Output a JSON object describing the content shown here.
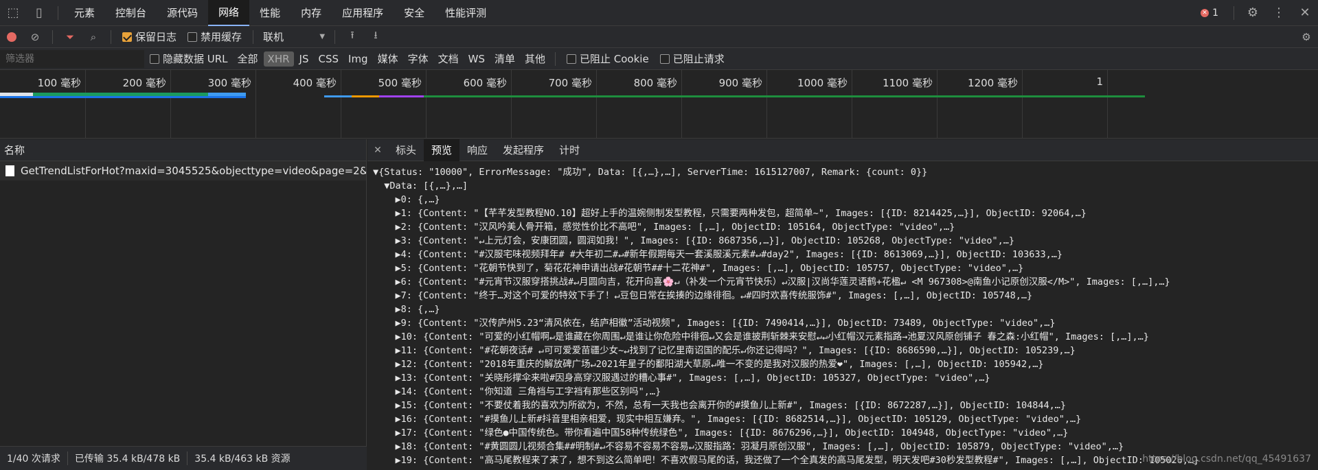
{
  "tabs": [
    "元素",
    "控制台",
    "源代码",
    "网络",
    "性能",
    "内存",
    "应用程序",
    "安全",
    "性能评测"
  ],
  "active_tab": "网络",
  "error_count": "1",
  "toolbar": {
    "preserve_log": "保留日志",
    "disable_cache": "禁用缓存",
    "throttle": "联机"
  },
  "filterbar": {
    "placeholder": "筛选器",
    "hide_data_urls": "隐藏数据 URL",
    "types": [
      "全部",
      "XHR",
      "JS",
      "CSS",
      "Img",
      "媒体",
      "字体",
      "文档",
      "WS",
      "清单",
      "其他"
    ],
    "blocked_cookies": "已阻止 Cookie",
    "blocked_requests": "已阻止请求"
  },
  "timeline": {
    "ticks": [
      "100 毫秒",
      "200 毫秒",
      "300 毫秒",
      "400 毫秒",
      "500 毫秒",
      "600 毫秒",
      "700 毫秒",
      "800 毫秒",
      "900 毫秒",
      "1000 毫秒",
      "1100 毫秒",
      "1200 毫秒",
      "1"
    ]
  },
  "left": {
    "header": "名称",
    "request": "GetTrendListForHot?maxid=3045525&objecttype=video&page=2&count..."
  },
  "right_tabs": [
    "标头",
    "预览",
    "响应",
    "发起程序",
    "计时"
  ],
  "active_right_tab": "预览",
  "preview_lines": [
    "▼{Status: \"10000\", ErrorMessage: \"成功\", Data: [{,…},…], ServerTime: 1615127007, Remark: {count: 0}}",
    "  ▼Data: [{,…},…]",
    "    ▶0: {,…}",
    "    ▶1: {Content: \"【芊芊发型教程NO.10】超好上手的温婉侧制发型教程，只需要两种发包，超简单~\", Images: [{ID: 8214425,…}], ObjectID: 92064,…}",
    "    ▶2: {Content: \"汉风吟美人骨开箱，感觉性价比不高吧\", Images: [,…], ObjectID: 105164, ObjectType: \"video\",…}",
    "    ▶3: {Content: \"↵上元灯会，安康团圆，圆润如我！\", Images: [{ID: 8687356,…}], ObjectID: 105268, ObjectType: \"video\",…}",
    "    ▶4: {Content: \"#汉服宅味视频拜年# #大年初二#↵#新年假期每天一套溪服溪元素#↵#day2\", Images: [{ID: 8613069,…}], ObjectID: 103633,…}",
    "    ▶5: {Content: \"花朝节快到了，菊花花神申请出战#花朝节##十二花神#\", Images: [,…], ObjectID: 105757, ObjectType: \"video\",…}",
    "    ▶6: {Content: \"#元宵节汉服穿搭挑战#↵月圆向吉，花开向喜🌸↵（补发一个元宵节快乐）↵汉服|汉尚华莲灵语鹤+花楹↵ <M 967308>@南鱼小记原创汉服</M>\", Images: [,…],…}",
    "    ▶7: {Content: \"终于…对这个可爱的特效下手了！↵豆包日常在挨揍的边缘徘徊。↵#四时欢喜传统服饰#\", Images: [,…], ObjectID: 105748,…}",
    "    ▶8: {,…}",
    "    ▶9: {Content: \"汉传庐州5.23“清风依在，结庐相徽”活动视频\", Images: [{ID: 7490414,…}], ObjectID: 73489, ObjectType: \"video\",…}",
    "    ▶10: {Content: \"可爱的小红帽啊↵是谁藏在你周围↵是谁让你危险中徘徊↵又会是谁披荆斩棘来安慰↵↵小红帽汉元素指路→池夏汉风原创铺子 春之森:小红帽\", Images: [,…],…}",
    "    ▶11: {Content: \"#花朝夜话# ↵可可爱爱苗疆少女~↵找到了记忆里南诏国的配乐↵你还记得吗？\", Images: [{ID: 8686590,…}], ObjectID: 105239,…}",
    "    ▶12: {Content: \"2018年重庆的解放碑广场↵2021年星子的鄱阳湖大草原↵唯一不变的是我对汉服的热爱❤\", Images: [,…], ObjectID: 105942,…}",
    "    ▶13: {Content: \"关晓彤撑伞来啦#因身高穿汉服遇过的糟心事#\", Images: [,…], ObjectID: 105327, ObjectType: \"video\",…}",
    "    ▶14: {Content: \"你知道 三角裆与工字裆有那些区别吗\",…}",
    "    ▶15: {Content: \"不要仗着我的喜欢为所欲为，不然，总有一天我也会离开你的#摸鱼儿上新#\", Images: [{ID: 8672287,…}], ObjectID: 104844,…}",
    "    ▶16: {Content: \"#摸鱼儿上新#抖音里相亲相爱，现实中相互嫌弃。\", Images: [{ID: 8682514,…}], ObjectID: 105129, ObjectType: \"video\",…}",
    "    ▶17: {Content: \"绿色●中国传统色。带你看遍中国58种传统绿色\", Images: [{ID: 8676296,…}], ObjectID: 104948, ObjectType: \"video\",…}",
    "    ▶18: {Content: \"#黄圆圆儿视频合集##明制#↵不容易不容易不容易↵汉服指路：羽凝月原创汉服\", Images: [,…], ObjectID: 105879, ObjectType: \"video\",…}",
    "    ▶19: {Content: \"高马尾教程来了来了，想不到这么简单吧！不喜欢假马尾的话，我还做了一个全真发的高马尾发型，明天发吧#30秒发型教程#\", Images: [,…], ObjectID: 105026,…}"
  ],
  "status": [
    "1/40 次请求",
    "已传输 35.4 kB/478 kB",
    "35.4 kB/463 kB 资源"
  ],
  "watermark": "https://blog.csdn.net/qq_45491637"
}
